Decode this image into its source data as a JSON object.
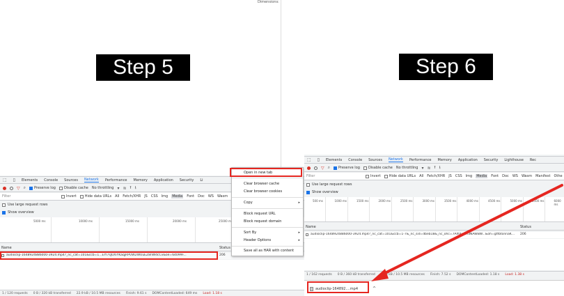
{
  "left": {
    "dimensions_label": "Dimensions: ",
    "step_label": "Step 5",
    "devtools": {
      "tabs": [
        {
          "label": "Elements"
        },
        {
          "label": "Console"
        },
        {
          "label": "Sources"
        },
        {
          "label": "Network",
          "selected": true
        },
        {
          "label": "Performance"
        },
        {
          "label": "Memory"
        },
        {
          "label": "Application"
        },
        {
          "label": "Security"
        },
        {
          "label": "Li"
        }
      ],
      "toolbar": {
        "preserve_log": "Preserve log",
        "disable_cache": "Disable cache",
        "throttling": "No throttling"
      },
      "filter": {
        "placeholder": "Filter",
        "invert": "Invert",
        "hide_data_urls": "Hide data URLs",
        "types": [
          "All",
          "Fetch/XHR",
          "JS",
          "CSS",
          "Img",
          "Media",
          "Font",
          "Doc",
          "WS",
          "Wasm"
        ],
        "selected_type": "Media"
      },
      "options": {
        "large_rows": "Use large request rows",
        "show_overview": "Show overview"
      },
      "timeline_ticks": [
        "5000 ms",
        "10000 ms",
        "15000 ms",
        "20000 ms",
        "25000 ms"
      ],
      "table": {
        "col_name": "Name",
        "col_status": "Status",
        "rows": [
          {
            "name": "audioclip-1648924886000-3924.mp4?_nc_cat=101&ccb=1...EYI7sJUXiYKaqjRPUW2WUuEZ8nWdcCv&oe=64099F...",
            "status": "206"
          }
        ]
      },
      "statusbar": {
        "requests": "1 / 120 requests",
        "transferred": "0 B / 320 kB transferred",
        "resources": "22.9 kB / 10.5 MB resources",
        "finish": "Finish: 9.61 s",
        "dom": "DOMContentLoaded: 649 ms",
        "load": "Load: 1.18 s"
      }
    },
    "context_menu": {
      "items": [
        {
          "label": "Open in new tab",
          "highlighted": true
        },
        {
          "label": "Clear browser cache"
        },
        {
          "label": "Clear browser cookies"
        },
        {
          "label": "Copy",
          "submenu": true
        },
        {
          "label": "Block request URL"
        },
        {
          "label": "Block request domain"
        },
        {
          "label": "Sort By",
          "submenu": true
        },
        {
          "label": "Header Options",
          "submenu": true
        },
        {
          "label": "Save all as HAR with content"
        }
      ]
    }
  },
  "right": {
    "step_label": "Step 6",
    "devtools": {
      "tabs": [
        {
          "label": "Elements"
        },
        {
          "label": "Console"
        },
        {
          "label": "Sources"
        },
        {
          "label": "Network",
          "selected": true
        },
        {
          "label": "Performance"
        },
        {
          "label": "Memory"
        },
        {
          "label": "Application"
        },
        {
          "label": "Security"
        },
        {
          "label": "Lighthouse"
        },
        {
          "label": "Rec"
        }
      ],
      "toolbar": {
        "preserve_log": "Preserve log",
        "disable_cache": "Disable cache",
        "throttling": "No throttling"
      },
      "filter": {
        "placeholder": "Filter",
        "invert": "Invert",
        "hide_data_urls": "Hide data URLs",
        "types": [
          "All",
          "Fetch/XHR",
          "JS",
          "CSS",
          "Img",
          "Media",
          "Font",
          "Doc",
          "WS",
          "Wasm",
          "Manifest",
          "Othe"
        ],
        "selected_type": "Media"
      },
      "options": {
        "large_rows": "Use large request rows",
        "show_overview": "Show overview"
      },
      "timeline_ticks": [
        "500 ms",
        "1000 ms",
        "1500 ms",
        "2000 ms",
        "2500 ms",
        "3000 ms",
        "3500 ms",
        "4000 ms",
        "4500 ms",
        "5000 ms",
        "5500 ms",
        "6000 ms"
      ],
      "table": {
        "col_name": "Name",
        "col_status": "Status",
        "rows": [
          {
            "name": "audioclip-1648924886000-3924.mp4?_nc_cat=101&ccb=1-7&_nc_sid=dbeb18&_nc_ohc=7AlfiXuOR3NAWBW...&oh=gtfbtonnaKw&oe=64099F...",
            "status": "206"
          }
        ]
      },
      "statusbar": {
        "requests": "1 / 162 requests",
        "transferred": "0 B / 360 kB transferred",
        "resources": "22.9 kB / 10.5 MB resources",
        "finish": "Finish: 7.52 s",
        "dom": "DOMContentLoaded: 1.18 s",
        "load": "Load: 1.38 s"
      }
    },
    "download": {
      "filename": "audioclip-164892....mp4",
      "chevron": "^"
    }
  },
  "colors": {
    "annotation_red": "#e52620",
    "accent_blue": "#1a73e8",
    "record_red": "#d93025"
  }
}
